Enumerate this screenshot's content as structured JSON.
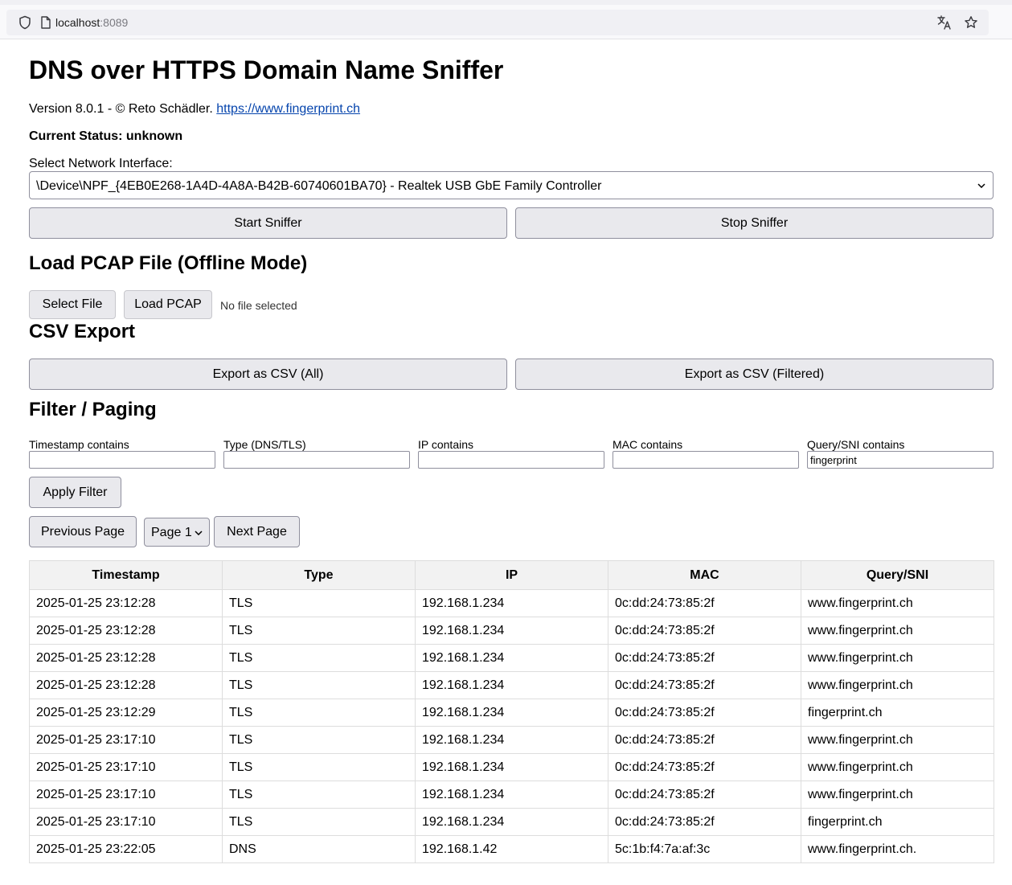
{
  "browser": {
    "url_host": "localhost",
    "url_port": ":8089",
    "icons": [
      "shield-icon",
      "page-icon",
      "translate-icon",
      "bookmark-star-icon"
    ]
  },
  "page": {
    "title": "DNS over HTTPS Domain Name Sniffer",
    "version_text": "Version 8.0.1 - © Reto Schädler.",
    "version_link": "https://www.fingerprint.ch",
    "status": "Current Status: unknown",
    "iface_label": "Select Network Interface:",
    "iface_selected": "\\Device\\NPF_{4EB0E268-1A4D-4A8A-B42B-60740601BA70} - Realtek USB GbE Family Controller",
    "start_button": "Start Sniffer",
    "stop_button": "Stop Sniffer"
  },
  "pcap": {
    "heading": "Load PCAP File (Offline Mode)",
    "select_button": "Select File",
    "load_button": "Load PCAP",
    "no_file": "No file selected"
  },
  "csv": {
    "heading": "CSV Export",
    "export_all": "Export as CSV (All)",
    "export_filtered": "Export as CSV (Filtered)"
  },
  "filter": {
    "heading": "Filter / Paging",
    "timestamp_label": "Timestamp contains",
    "timestamp_value": "",
    "type_label": "Type (DNS/TLS)",
    "type_value": "",
    "ip_label": "IP contains",
    "ip_value": "",
    "mac_label": "MAC contains",
    "mac_value": "",
    "query_label": "Query/SNI contains",
    "query_value": "fingerprint",
    "apply_button": "Apply Filter",
    "prev_button": "Previous Page",
    "page_selected": "Page 1",
    "next_button": "Next Page"
  },
  "table": {
    "headers": [
      "Timestamp",
      "Type",
      "IP",
      "MAC",
      "Query/SNI"
    ],
    "rows": [
      [
        "2025-01-25 23:12:28",
        "TLS",
        "192.168.1.234",
        "0c:dd:24:73:85:2f",
        "www.fingerprint.ch"
      ],
      [
        "2025-01-25 23:12:28",
        "TLS",
        "192.168.1.234",
        "0c:dd:24:73:85:2f",
        "www.fingerprint.ch"
      ],
      [
        "2025-01-25 23:12:28",
        "TLS",
        "192.168.1.234",
        "0c:dd:24:73:85:2f",
        "www.fingerprint.ch"
      ],
      [
        "2025-01-25 23:12:28",
        "TLS",
        "192.168.1.234",
        "0c:dd:24:73:85:2f",
        "www.fingerprint.ch"
      ],
      [
        "2025-01-25 23:12:29",
        "TLS",
        "192.168.1.234",
        "0c:dd:24:73:85:2f",
        "fingerprint.ch"
      ],
      [
        "2025-01-25 23:17:10",
        "TLS",
        "192.168.1.234",
        "0c:dd:24:73:85:2f",
        "www.fingerprint.ch"
      ],
      [
        "2025-01-25 23:17:10",
        "TLS",
        "192.168.1.234",
        "0c:dd:24:73:85:2f",
        "www.fingerprint.ch"
      ],
      [
        "2025-01-25 23:17:10",
        "TLS",
        "192.168.1.234",
        "0c:dd:24:73:85:2f",
        "www.fingerprint.ch"
      ],
      [
        "2025-01-25 23:17:10",
        "TLS",
        "192.168.1.234",
        "0c:dd:24:73:85:2f",
        "fingerprint.ch"
      ],
      [
        "2025-01-25 23:22:05",
        "DNS",
        "192.168.1.42",
        "5c:1b:f4:7a:af:3c",
        "www.fingerprint.ch."
      ]
    ]
  },
  "colors": {
    "link": "#0645ad",
    "button_bg": "#e9e9ed",
    "header_bg": "#f2f2f2",
    "cell_border": "#dddddd"
  }
}
